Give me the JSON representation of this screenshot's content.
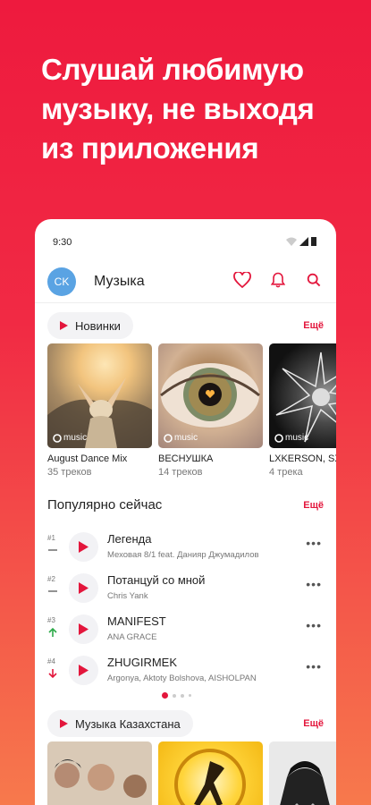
{
  "promo": {
    "line1": "Слушай любимую",
    "line2": "музыку, не выходя",
    "line3": "из приложения"
  },
  "status": {
    "time": "9:30"
  },
  "appbar": {
    "avatar": "CK",
    "title": "Музыка"
  },
  "new_section": {
    "label": "Новинки",
    "more": "Ещё",
    "cards": [
      {
        "title": "August Dance Mix",
        "subtitle": "35 треков",
        "logo": "music"
      },
      {
        "title": "ВЕСНУШКА",
        "subtitle": "14 треков",
        "logo": "music"
      },
      {
        "title": "LXKERSON, SX",
        "subtitle": "4 трека",
        "logo": "music"
      }
    ]
  },
  "popular": {
    "title": "Популярно сейчас",
    "more": "Ещё",
    "tracks": [
      {
        "rank": "#1",
        "trend": "same",
        "title": "Легенда",
        "artist": "Меховая 8/1 feat. Данияр Джумадилов"
      },
      {
        "rank": "#2",
        "trend": "same",
        "title": "Потанцуй со мной",
        "artist": "Chris Yank"
      },
      {
        "rank": "#3",
        "trend": "up",
        "title": "MANIFEST",
        "artist": "ANA GRACE"
      },
      {
        "rank": "#4",
        "trend": "down",
        "title": "ZHUGIRMEK",
        "artist": "Argonya, Aktoty Bolshova, AISHOLPAN"
      }
    ]
  },
  "kz_section": {
    "label": "Музыка Казахстана",
    "more": "Ещё"
  },
  "colors": {
    "accent": "#e3163c",
    "trend_up": "#2eaa4a",
    "trend_down": "#e3163c"
  }
}
